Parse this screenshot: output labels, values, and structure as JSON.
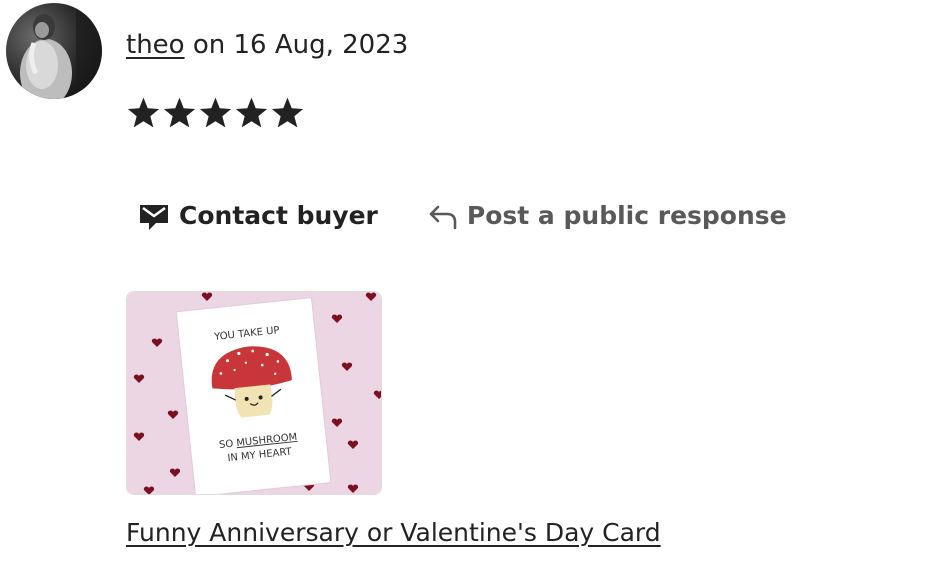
{
  "review": {
    "reviewer_name": "theo",
    "date_text": " on 16 Aug, 2023",
    "rating": 5,
    "rating_max": 5
  },
  "actions": {
    "contact_label": "Contact buyer",
    "respond_label": "Post a public response"
  },
  "item": {
    "title": "Funny Anniversary or Valentine's Day Card",
    "card_text": {
      "line1": "YOU TAKE UP",
      "line2_prefix": "SO ",
      "line2_underlined": "MUSHROOM",
      "line3": "IN MY HEART"
    }
  },
  "colors": {
    "text": "#222222",
    "muted": "#595959",
    "thumb_background": "#ecd6e4",
    "mushroom_cap": "#c8363a",
    "heart": "#7a1020"
  },
  "icons": {
    "contact": "envelope-icon",
    "respond": "reply-arrow-icon",
    "star": "star-icon"
  }
}
